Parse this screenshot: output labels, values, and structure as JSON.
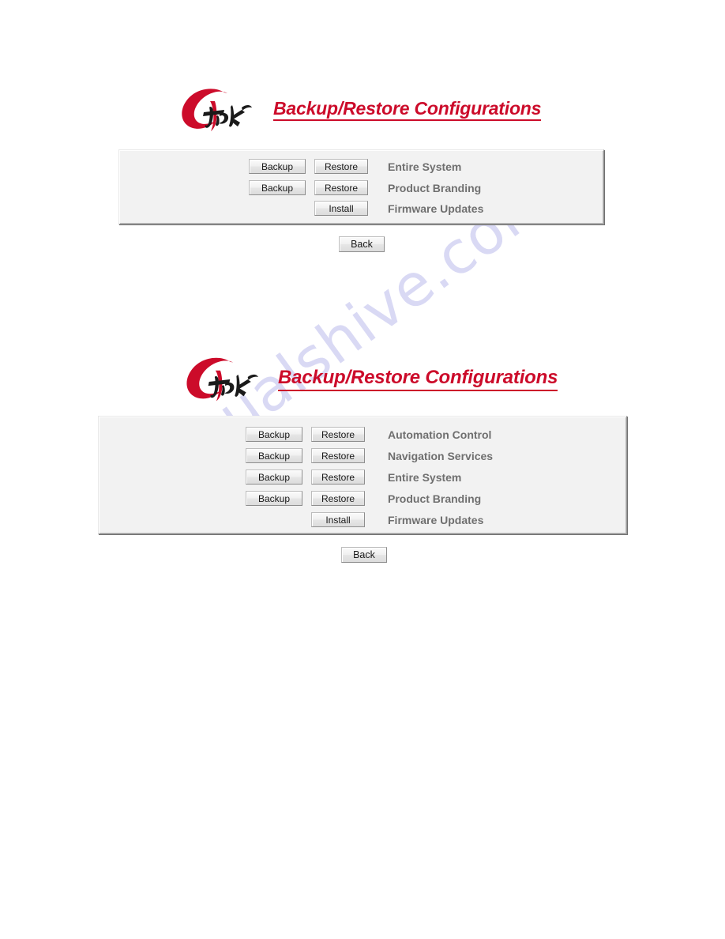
{
  "document": {
    "background_color": "#ffffff",
    "watermark_text": "manualshive.com",
    "watermark_color": "#d9d9f4"
  },
  "brand": {
    "logo_name": "ctek-logo",
    "logo_c_text": "C",
    "logo_tek_text": "tek",
    "logo_c_color": "#cc0b2a",
    "logo_tek_color": "#1a1a1a"
  },
  "colors": {
    "heading": "#cc0b2a",
    "row_label": "#6f6f6f",
    "panel_background": "#f2f2f2",
    "panel_border": "#9a9a9a",
    "button_face": "#ededed"
  },
  "buttons": {
    "backup_label": "Backup",
    "restore_label": "Restore",
    "install_label": "Install",
    "back_label": "Back"
  },
  "screens": [
    {
      "id": "screen-1",
      "heading": "Backup/Restore Configurations",
      "rows": [
        {
          "label": "Entire System",
          "actions": [
            "Backup",
            "Restore"
          ]
        },
        {
          "label": "Product Branding",
          "actions": [
            "Backup",
            "Restore"
          ]
        },
        {
          "label": "Firmware Updates",
          "actions": [
            "Install"
          ]
        }
      ],
      "back_label": "Back"
    },
    {
      "id": "screen-2",
      "heading": "Backup/Restore Configurations",
      "rows": [
        {
          "label": "Automation Control",
          "actions": [
            "Backup",
            "Restore"
          ]
        },
        {
          "label": "Navigation Services",
          "actions": [
            "Backup",
            "Restore"
          ]
        },
        {
          "label": "Entire System",
          "actions": [
            "Backup",
            "Restore"
          ]
        },
        {
          "label": "Product Branding",
          "actions": [
            "Backup",
            "Restore"
          ]
        },
        {
          "label": "Firmware Updates",
          "actions": [
            "Install"
          ]
        }
      ],
      "back_label": "Back"
    }
  ]
}
